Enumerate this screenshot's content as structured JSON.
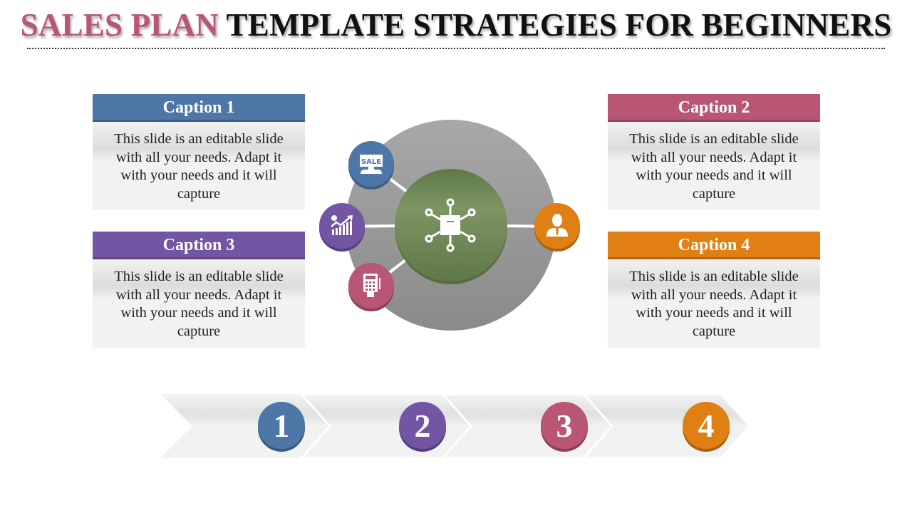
{
  "title": {
    "accent": "SALES PLAN",
    "rest": "TEMPLATE STRATEGIES FOR BEGINNERS",
    "accent_color": "#b85674"
  },
  "captions": [
    {
      "label": "Caption 1",
      "text": "This slide is an editable slide with all your needs. Adapt it with your needs and it will capture",
      "color": "#4e76a6"
    },
    {
      "label": "Caption 2",
      "text": "This slide is an editable slide with all your needs. Adapt it with your needs and it will capture",
      "color": "#b85674"
    },
    {
      "label": "Caption 3",
      "text": "This slide is an editable slide with all your needs. Adapt it with your needs and it will capture",
      "color": "#7255a3"
    },
    {
      "label": "Caption 4",
      "text": "This slide is an editable slide with all your needs. Adapt it with your needs and it will capture",
      "color": "#e07f14"
    }
  ],
  "hub": {
    "center_icon": "network-box-icon",
    "center_color": "#718d59",
    "ring_color": "#9e9e9e",
    "satellites": [
      {
        "icon": "sale-sign-icon",
        "text": "SALE",
        "color": "#4e76a6"
      },
      {
        "icon": "growth-chart-icon",
        "color": "#7255a3"
      },
      {
        "icon": "card-terminal-icon",
        "color": "#b85674"
      },
      {
        "icon": "businessman-icon",
        "color": "#e07f14"
      }
    ]
  },
  "steps": [
    {
      "number": "1",
      "color": "#4e76a6"
    },
    {
      "number": "2",
      "color": "#7255a3"
    },
    {
      "number": "3",
      "color": "#b85674"
    },
    {
      "number": "4",
      "color": "#e07f14"
    }
  ]
}
